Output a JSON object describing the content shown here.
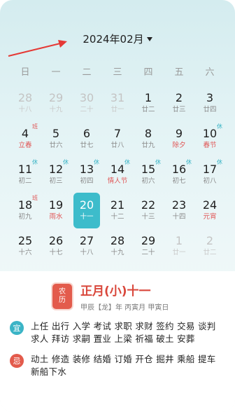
{
  "header": {
    "month_label": "2024年02月"
  },
  "weekdays": [
    "日",
    "一",
    "二",
    "三",
    "四",
    "五",
    "六"
  ],
  "days": [
    {
      "d": "28",
      "l": "十八",
      "other": true
    },
    {
      "d": "29",
      "l": "十九",
      "other": true
    },
    {
      "d": "30",
      "l": "二十",
      "other": true
    },
    {
      "d": "31",
      "l": "廿一",
      "other": true
    },
    {
      "d": "1",
      "l": "廿二"
    },
    {
      "d": "2",
      "l": "廿三"
    },
    {
      "d": "3",
      "l": "廿四"
    },
    {
      "d": "4",
      "l": "立春",
      "red": true,
      "badge": "班",
      "badge_type": "work"
    },
    {
      "d": "5",
      "l": "廿六"
    },
    {
      "d": "6",
      "l": "廿七"
    },
    {
      "d": "7",
      "l": "廿八"
    },
    {
      "d": "8",
      "l": "廿九"
    },
    {
      "d": "9",
      "l": "除夕",
      "red": true
    },
    {
      "d": "10",
      "l": "春节",
      "red": true,
      "badge": "休",
      "badge_type": "rest"
    },
    {
      "d": "11",
      "l": "初二",
      "badge": "休",
      "badge_type": "rest"
    },
    {
      "d": "12",
      "l": "初三",
      "badge": "休",
      "badge_type": "rest"
    },
    {
      "d": "13",
      "l": "初四",
      "badge": "休",
      "badge_type": "rest"
    },
    {
      "d": "14",
      "l": "情人节",
      "red": true,
      "badge": "休",
      "badge_type": "rest"
    },
    {
      "d": "15",
      "l": "初六",
      "badge": "休",
      "badge_type": "rest"
    },
    {
      "d": "16",
      "l": "初七",
      "badge": "休",
      "badge_type": "rest"
    },
    {
      "d": "17",
      "l": "初八",
      "badge": "休",
      "badge_type": "rest"
    },
    {
      "d": "18",
      "l": "初九",
      "badge": "班",
      "badge_type": "work"
    },
    {
      "d": "19",
      "l": "雨水",
      "red": true
    },
    {
      "d": "20",
      "l": "十一",
      "today": true
    },
    {
      "d": "21",
      "l": "十二"
    },
    {
      "d": "22",
      "l": "十三"
    },
    {
      "d": "23",
      "l": "十四"
    },
    {
      "d": "24",
      "l": "元宵",
      "red": true
    },
    {
      "d": "25",
      "l": "十六"
    },
    {
      "d": "26",
      "l": "十七"
    },
    {
      "d": "27",
      "l": "十八"
    },
    {
      "d": "28",
      "l": "十九"
    },
    {
      "d": "29",
      "l": "二十"
    },
    {
      "d": "1",
      "l": "廿一",
      "other": true
    },
    {
      "d": "2",
      "l": "廿二",
      "other": true
    }
  ],
  "lunar": {
    "icon_top": "农",
    "icon_bottom": "历",
    "title": "正月(小)十一",
    "subtitle": "甲辰【龙】年 丙寅月 甲寅日"
  },
  "yi": {
    "label": "宜",
    "text": "上任 出行 入学 考试 求职 求财 签约 交易 谈判 求人 拜访 求嗣 置业 上梁 祈福 破土 安葬"
  },
  "ji": {
    "label": "忌",
    "text": "动土 修造 装修 结婚 订婚 开仓 掘井 乘船 提车 新船下水"
  },
  "colors": {
    "accent": "#3dbccb",
    "red": "#e35b4c",
    "arrow": "#e53935"
  }
}
